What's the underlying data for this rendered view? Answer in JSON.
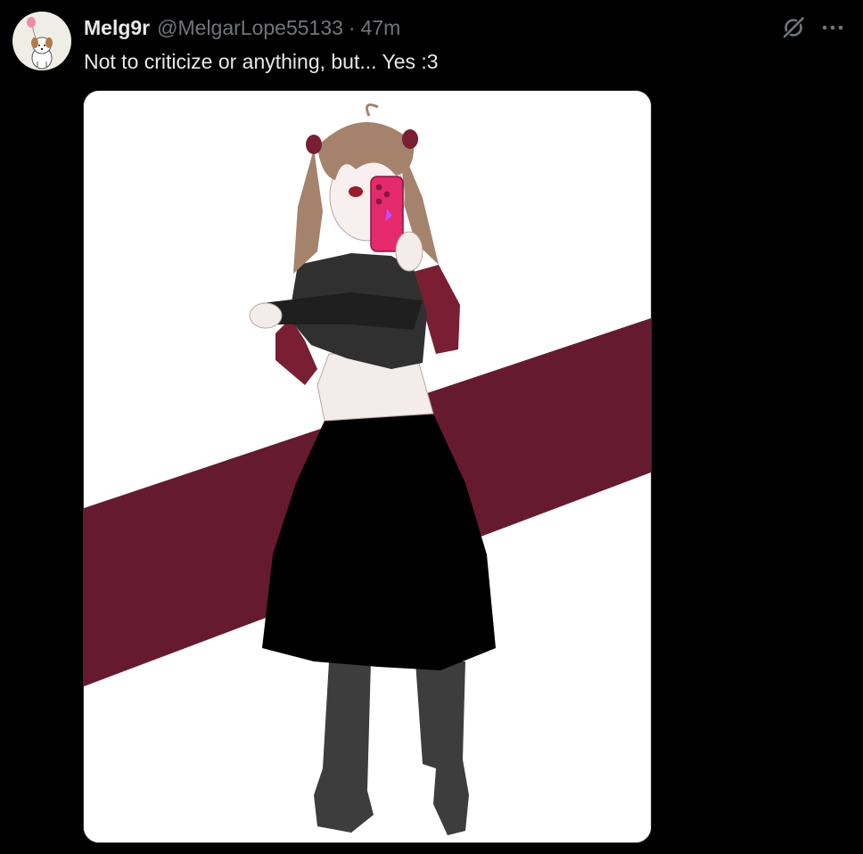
{
  "post": {
    "author": {
      "display_name": "Melg9r",
      "handle": "@MelgarLope55133",
      "separator": "·",
      "time": "47m",
      "avatar_icon": "dog-with-balloon-avatar"
    },
    "text": "Not to criticize or anything, but... Yes :3",
    "actions": {
      "grok_icon": "grok-icon",
      "more_icon": "more-icon"
    },
    "media": {
      "type": "illustration",
      "background_color": "#ffffff",
      "stripe_color": "#651a30"
    }
  },
  "theme": {
    "background": "#000000",
    "text_primary": "#e7e9ea",
    "text_secondary": "#71767b",
    "border": "#2f3336"
  }
}
